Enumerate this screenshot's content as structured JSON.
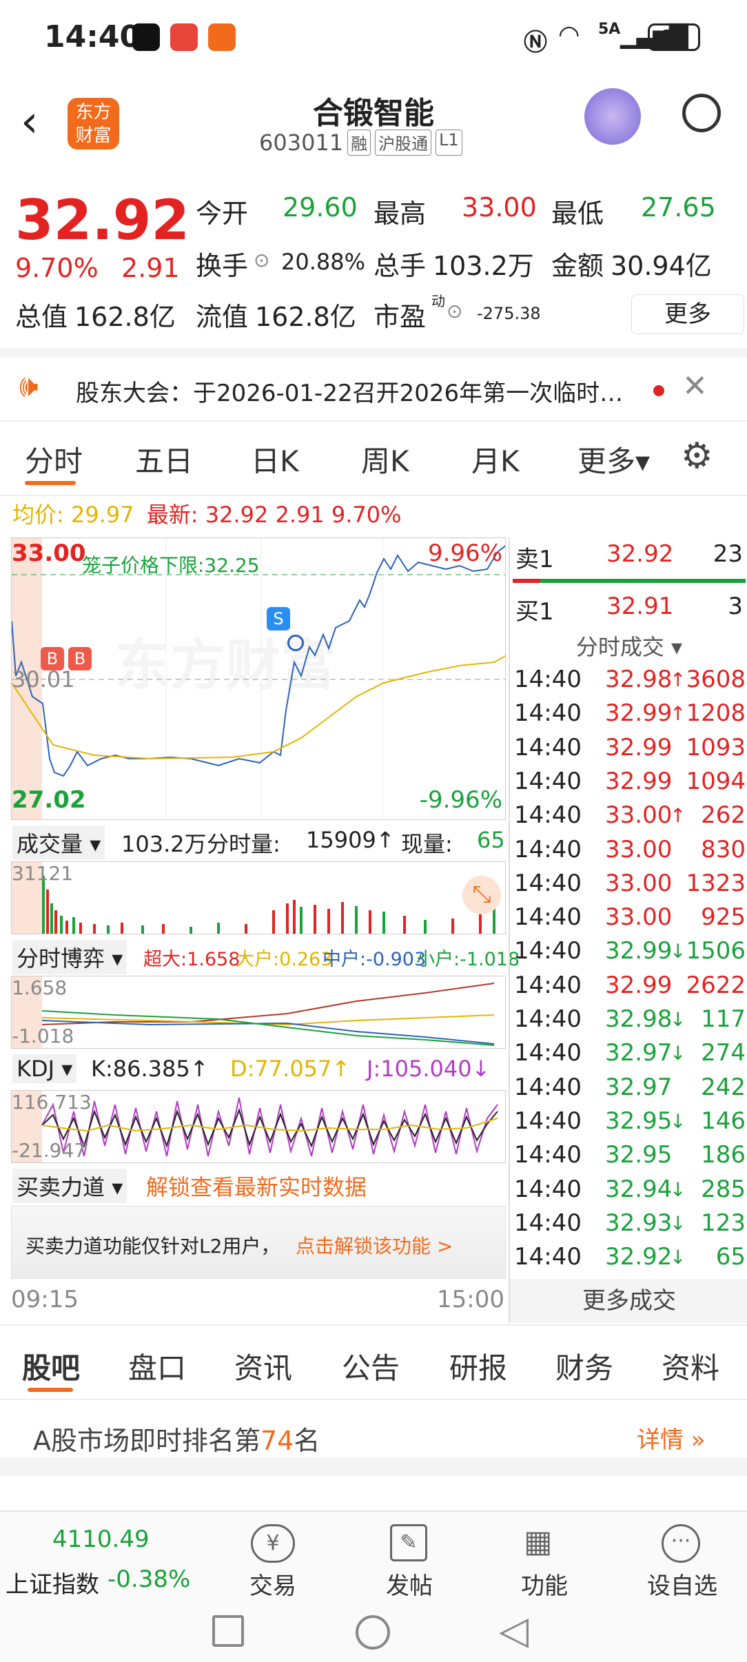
{
  "status_bar": {
    "time": "14:40",
    "battery": "86",
    "network": "5A"
  },
  "header": {
    "title": "合锻智能",
    "code": "603011",
    "tags": [
      "融",
      "沪股通",
      "L1"
    ],
    "logo": "东方财富"
  },
  "quote": {
    "price": "32.92",
    "pct": "9.70%",
    "chg": "2.91",
    "open_label": "今开",
    "open": "29.60",
    "high_label": "最高",
    "high": "33.00",
    "low_label": "最低",
    "low": "27.65",
    "turnover_label": "换手",
    "turnover": "20.88%",
    "vol_label": "总手",
    "vol": "103.2万",
    "amount_label": "金额",
    "amount": "30.94亿",
    "mcap_label": "总值",
    "mcap": "162.8亿",
    "float_label": "流值",
    "float": "162.8亿",
    "pe_label": "市盈",
    "pe_sup": "动",
    "pe": "-275.38",
    "more": "更多"
  },
  "notice": {
    "text": "股东大会：于2026-01-22召开2026年第一次临时…"
  },
  "chart_tabs": [
    "分时",
    "五日",
    "日K",
    "周K",
    "月K",
    "更多▾"
  ],
  "avg_line": {
    "avg_label": "均价: 29.97",
    "latest_label": "最新: 32.92 2.91 9.70%"
  },
  "main_chart": {
    "top": "33.00",
    "bottom": "27.02",
    "mid": "30.01",
    "top_pct": "9.96%",
    "bottom_pct": "-9.96%",
    "limit_label": "笼子价格下限:32.25",
    "watermark": "东方财富",
    "time_start": "09:15",
    "time_end": "15:00",
    "markers": [
      "B",
      "B",
      "S"
    ]
  },
  "volume": {
    "label": "成交量",
    "total": "103.2万",
    "fs_label": "分时量:",
    "fs": "15909↑",
    "now_label": "现量:",
    "now": "65",
    "max": "31121"
  },
  "bo": {
    "label": "分时博弈",
    "big": "超大:1.658",
    "large": "大户:0.263",
    "mid": "中户:-0.903",
    "small": "小户:-1.018",
    "top": "1.658",
    "bottom": "-1.018"
  },
  "kdj": {
    "label": "KDJ",
    "k": "K:86.385↑",
    "d": "D:77.057↑",
    "j": "J:105.040↓",
    "top": "116.713",
    "bottom": "-21.947"
  },
  "force": {
    "label": "买卖力道",
    "unlock": "解锁查看最新实时数据",
    "msg": "买卖力道功能仅针对L2用户，",
    "link": "点击解锁该功能 >"
  },
  "orderbook": {
    "sell_label": "卖1",
    "sell_price": "32.92",
    "sell_vol": "23",
    "buy_label": "买1",
    "buy_price": "32.91",
    "buy_vol": "3",
    "trades_title": "分时成交 ▾",
    "more": "更多成交"
  },
  "trades": [
    {
      "t": "14:40",
      "p": "32.98",
      "v": "3608",
      "d": "↑",
      "c": "red"
    },
    {
      "t": "14:40",
      "p": "32.99",
      "v": "1208",
      "d": "↑",
      "c": "red"
    },
    {
      "t": "14:40",
      "p": "32.99",
      "v": "1093",
      "d": "",
      "c": "red"
    },
    {
      "t": "14:40",
      "p": "32.99",
      "v": "1094",
      "d": "",
      "c": "red"
    },
    {
      "t": "14:40",
      "p": "33.00",
      "v": "262",
      "d": "↑",
      "c": "red"
    },
    {
      "t": "14:40",
      "p": "33.00",
      "v": "830",
      "d": "",
      "c": "red"
    },
    {
      "t": "14:40",
      "p": "33.00",
      "v": "1323",
      "d": "",
      "c": "red"
    },
    {
      "t": "14:40",
      "p": "33.00",
      "v": "925",
      "d": "",
      "c": "red"
    },
    {
      "t": "14:40",
      "p": "32.99",
      "v": "1506",
      "d": "↓",
      "c": "green"
    },
    {
      "t": "14:40",
      "p": "32.99",
      "v": "2622",
      "d": "",
      "c": "red"
    },
    {
      "t": "14:40",
      "p": "32.98",
      "v": "117",
      "d": "↓",
      "c": "green"
    },
    {
      "t": "14:40",
      "p": "32.97",
      "v": "274",
      "d": "↓",
      "c": "green"
    },
    {
      "t": "14:40",
      "p": "32.97",
      "v": "242",
      "d": "",
      "c": "green"
    },
    {
      "t": "14:40",
      "p": "32.95",
      "v": "146",
      "d": "↓",
      "c": "green"
    },
    {
      "t": "14:40",
      "p": "32.95",
      "v": "186",
      "d": "",
      "c": "green"
    },
    {
      "t": "14:40",
      "p": "32.94",
      "v": "285",
      "d": "↓",
      "c": "green"
    },
    {
      "t": "14:40",
      "p": "32.93",
      "v": "123",
      "d": "↓",
      "c": "green"
    },
    {
      "t": "14:40",
      "p": "32.92",
      "v": "65",
      "d": "↓",
      "c": "green"
    }
  ],
  "bottom_tabs": [
    "股吧",
    "盘口",
    "资讯",
    "公告",
    "研报",
    "财务",
    "资料"
  ],
  "rank": {
    "prefix": "A股市场即时排名第",
    "num": "74",
    "suffix": "名",
    "detail": "详情 »"
  },
  "nav": {
    "index_val": "4110.49",
    "index_name": "上证指数",
    "index_pct": "-0.38%",
    "items": [
      "交易",
      "发帖",
      "功能",
      "设自选"
    ]
  }
}
